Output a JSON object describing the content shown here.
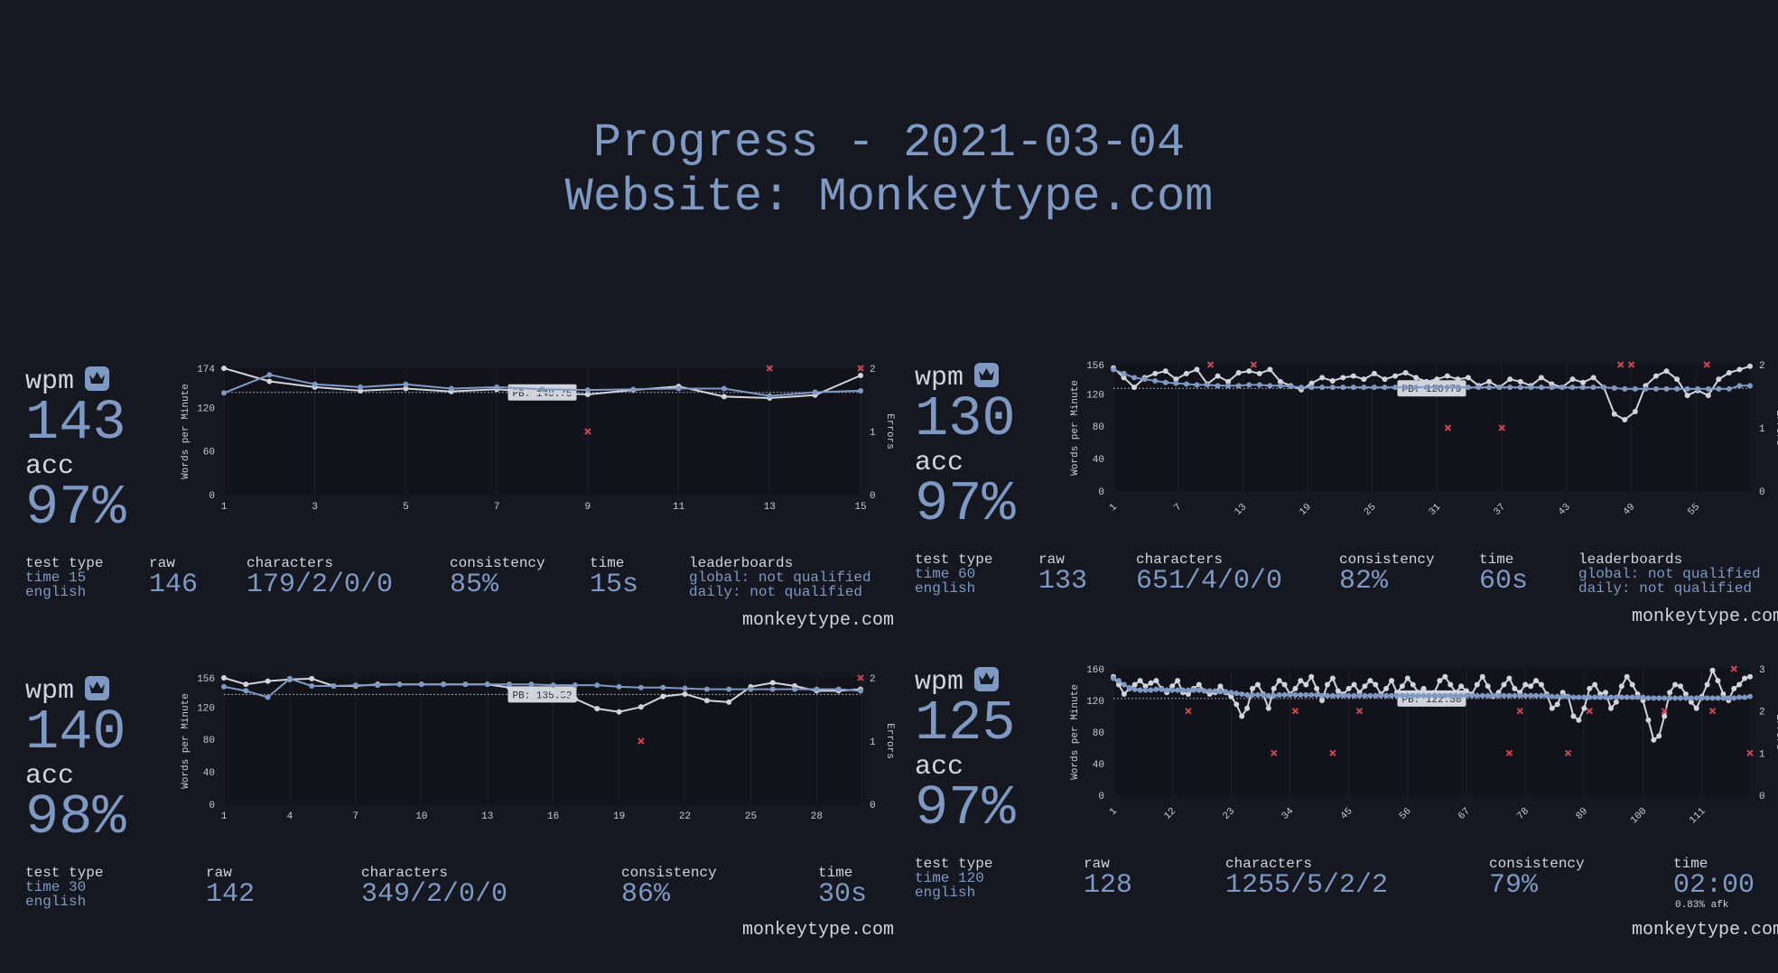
{
  "header": {
    "line1": "Progress - 2021-03-04",
    "line2": "Website: Monkeytype.com"
  },
  "labels": {
    "wpm": "wpm",
    "acc": "acc",
    "ylabel_left": "Words per Minute",
    "ylabel_right": "Errors",
    "pb_prefix": "PB: ",
    "test_type": "test type",
    "raw": "raw",
    "characters": "characters",
    "consistency": "consistency",
    "time": "time",
    "leaderboards": "leaderboards",
    "brand": "monkeytype.com"
  },
  "colors": {
    "bg": "#151821",
    "plot_bg": "#12131a",
    "accent": "#7f99c2",
    "text": "#d1d4db",
    "error": "#ca4754"
  },
  "panels": [
    {
      "wpm": "143",
      "acc": "97%",
      "test_type": "time 15",
      "language": "english",
      "raw": "146",
      "characters": "179/2/0/0",
      "consistency": "85%",
      "time": "15s",
      "leaderboards_global": "global: not qualified",
      "leaderboards_daily": "daily: not qualified",
      "afk": ""
    },
    {
      "wpm": "130",
      "acc": "97%",
      "test_type": "time 60",
      "language": "english",
      "raw": "133",
      "characters": "651/4/0/0",
      "consistency": "82%",
      "time": "60s",
      "leaderboards_global": "global: not qualified",
      "leaderboards_daily": "daily: not qualified",
      "afk": ""
    },
    {
      "wpm": "140",
      "acc": "98%",
      "test_type": "time 30",
      "language": "english",
      "raw": "142",
      "characters": "349/2/0/0",
      "consistency": "86%",
      "time": "30s",
      "leaderboards_global": "",
      "leaderboards_daily": "",
      "afk": ""
    },
    {
      "wpm": "125",
      "acc": "97%",
      "test_type": "time 120",
      "language": "english",
      "raw": "128",
      "characters": "1255/5/2/2",
      "consistency": "79%",
      "time": "02:00",
      "leaderboards_global": "",
      "leaderboards_daily": "",
      "afk": "0.83% afk"
    }
  ],
  "chart_data": [
    {
      "type": "line",
      "pb": "140.75",
      "ymax": 174,
      "yticks": [
        0,
        60,
        120,
        174
      ],
      "xtick_labels": [
        "1",
        "3",
        "5",
        "7",
        "9",
        "11",
        "13",
        "15"
      ],
      "xmax": 15,
      "errmax": 2,
      "err_ticks": [
        0,
        1,
        2
      ],
      "series": [
        {
          "name": "raw",
          "values": [
            174,
            156,
            148,
            143,
            146,
            142,
            145,
            140,
            138,
            144,
            149,
            135,
            133,
            137,
            164
          ]
        },
        {
          "name": "wpm",
          "values": [
            140,
            165,
            152,
            148,
            152,
            146,
            148,
            145,
            144,
            145,
            146,
            146,
            136,
            141,
            143
          ]
        }
      ],
      "errors": [
        [
          9,
          1
        ],
        [
          13,
          2
        ],
        [
          15,
          2
        ]
      ]
    },
    {
      "type": "line",
      "pb": "126.79",
      "ymax": 156,
      "yticks": [
        0,
        40,
        80,
        120,
        156
      ],
      "xtick_labels": [
        "1",
        "7",
        "13",
        "19",
        "25",
        "31",
        "37",
        "43",
        "49",
        "55"
      ],
      "xmax": 60,
      "errmax": 2,
      "err_ticks": [
        0,
        1,
        2
      ],
      "series": [
        {
          "name": "raw",
          "values": [
            152,
            140,
            128,
            140,
            145,
            148,
            138,
            145,
            150,
            132,
            142,
            135,
            146,
            148,
            145,
            150,
            135,
            130,
            125,
            133,
            140,
            136,
            140,
            142,
            138,
            145,
            138,
            142,
            146,
            140,
            135,
            138,
            142,
            138,
            140,
            130,
            135,
            128,
            138,
            135,
            130,
            140,
            132,
            128,
            138,
            134,
            140,
            128,
            95,
            88,
            98,
            130,
            142,
            148,
            138,
            118,
            124,
            118,
            138,
            146,
            150,
            154
          ]
        },
        {
          "name": "wpm",
          "values": [
            150,
            145,
            140,
            138,
            136,
            134,
            133,
            132,
            131,
            131,
            130,
            130,
            130,
            131,
            131,
            130,
            130,
            129,
            128,
            128,
            128,
            128,
            128,
            128,
            128,
            128,
            128,
            128,
            128,
            128,
            128,
            128,
            128,
            128,
            128,
            128,
            128,
            128,
            128,
            128,
            128,
            128,
            128,
            128,
            128,
            128,
            128,
            128,
            127,
            126,
            126,
            126,
            126,
            126,
            126,
            126,
            126,
            126,
            126,
            126,
            130,
            130
          ]
        }
      ],
      "errors": [
        [
          10,
          2
        ],
        [
          14,
          2
        ],
        [
          32,
          1
        ],
        [
          37,
          1
        ],
        [
          48,
          2
        ],
        [
          49,
          2
        ],
        [
          56,
          2
        ]
      ]
    },
    {
      "type": "line",
      "pb": "135.52",
      "ymax": 156,
      "yticks": [
        0,
        40,
        80,
        120,
        156
      ],
      "xtick_labels": [
        "1",
        "4",
        "7",
        "10",
        "13",
        "16",
        "19",
        "22",
        "25",
        "28"
      ],
      "xmax": 30,
      "errmax": 2,
      "err_ticks": [
        0,
        1,
        2
      ],
      "series": [
        {
          "name": "raw",
          "values": [
            156,
            148,
            152,
            154,
            155,
            146,
            146,
            148,
            148,
            148,
            148,
            148,
            148,
            144,
            140,
            140,
            130,
            118,
            114,
            120,
            133,
            136,
            128,
            126,
            145,
            150,
            146,
            140,
            140,
            142
          ]
        },
        {
          "name": "wpm",
          "values": [
            145,
            140,
            132,
            155,
            146,
            146,
            147,
            147,
            148,
            148,
            148,
            148,
            148,
            148,
            148,
            147,
            147,
            147,
            145,
            144,
            144,
            143,
            142,
            142,
            142,
            142,
            142,
            142,
            142,
            140
          ]
        }
      ],
      "errors": [
        [
          20,
          1
        ],
        [
          30,
          2
        ]
      ]
    },
    {
      "type": "line",
      "pb": "122.38",
      "ymax": 160,
      "yticks": [
        0,
        40,
        80,
        120,
        160
      ],
      "xtick_labels": [
        "1",
        "12",
        "23",
        "34",
        "45",
        "56",
        "67",
        "78",
        "89",
        "100",
        "111"
      ],
      "xmax": 120,
      "errmax": 3,
      "err_ticks": [
        0,
        1,
        2,
        3
      ],
      "series": [
        {
          "name": "raw",
          "values": [
            150,
            140,
            128,
            135,
            140,
            145,
            138,
            142,
            145,
            135,
            130,
            138,
            145,
            130,
            128,
            135,
            140,
            132,
            128,
            130,
            138,
            130,
            125,
            115,
            100,
            110,
            135,
            140,
            128,
            110,
            135,
            145,
            140,
            128,
            135,
            145,
            140,
            150,
            135,
            120,
            140,
            148,
            132,
            128,
            135,
            140,
            130,
            138,
            145,
            140,
            128,
            135,
            145,
            130,
            138,
            148,
            140,
            130,
            135,
            128,
            130,
            145,
            150,
            140,
            130,
            138,
            132,
            128,
            140,
            150,
            138,
            125,
            130,
            140,
            148,
            135,
            130,
            140,
            138,
            145,
            140,
            128,
            110,
            115,
            130,
            125,
            100,
            95,
            110,
            135,
            140,
            128,
            130,
            110,
            118,
            138,
            150,
            140,
            128,
            120,
            95,
            70,
            75,
            100,
            130,
            140,
            138,
            128,
            118,
            110,
            125,
            140,
            158,
            145,
            128,
            120,
            135,
            140,
            148,
            150
          ]
        },
        {
          "name": "wpm",
          "values": [
            148,
            145,
            140,
            136,
            134,
            133,
            133,
            133,
            134,
            134,
            133,
            133,
            133,
            133,
            133,
            133,
            133,
            132,
            132,
            132,
            131,
            131,
            130,
            129,
            128,
            127,
            127,
            127,
            127,
            126,
            126,
            127,
            127,
            127,
            127,
            127,
            127,
            127,
            127,
            126,
            126,
            126,
            126,
            126,
            126,
            126,
            126,
            126,
            126,
            126,
            126,
            126,
            126,
            126,
            126,
            126,
            126,
            126,
            126,
            126,
            126,
            126,
            126,
            126,
            126,
            126,
            126,
            126,
            126,
            126,
            126,
            126,
            126,
            126,
            126,
            126,
            126,
            126,
            126,
            126,
            126,
            126,
            125,
            125,
            125,
            125,
            124,
            124,
            124,
            124,
            124,
            124,
            124,
            124,
            124,
            124,
            124,
            124,
            124,
            124,
            123,
            123,
            123,
            123,
            123,
            123,
            123,
            123,
            123,
            123,
            123,
            123,
            123,
            123,
            123,
            123,
            123,
            124,
            124,
            125
          ]
        }
      ],
      "errors": [
        [
          15,
          2
        ],
        [
          31,
          1
        ],
        [
          35,
          2
        ],
        [
          42,
          1
        ],
        [
          47,
          2
        ],
        [
          75,
          1
        ],
        [
          77,
          2
        ],
        [
          86,
          1
        ],
        [
          90,
          2
        ],
        [
          104,
          2
        ],
        [
          113,
          2
        ],
        [
          117,
          3
        ],
        [
          120,
          1
        ]
      ]
    }
  ]
}
